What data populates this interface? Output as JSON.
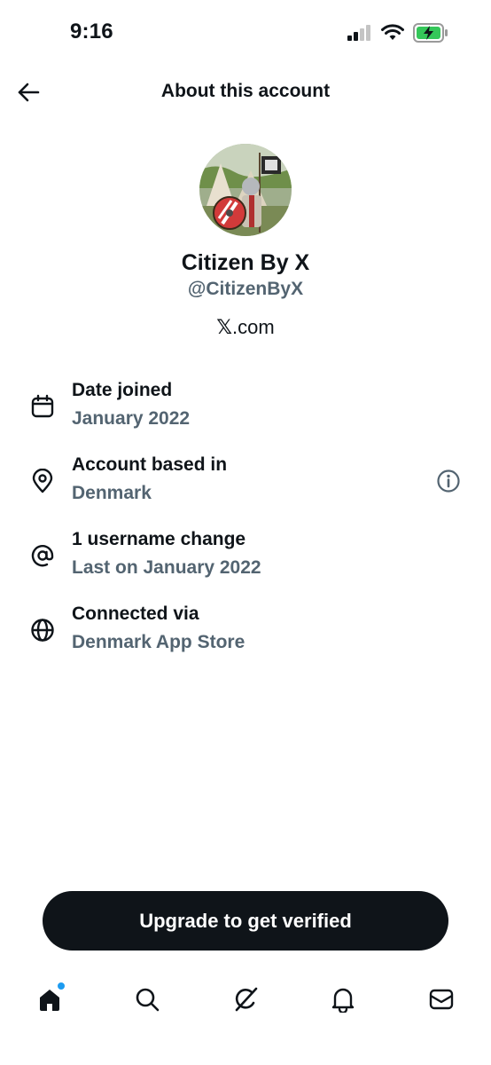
{
  "status_bar": {
    "time": "9:16"
  },
  "header": {
    "title": "About this account"
  },
  "profile": {
    "display_name": "Citizen By X",
    "handle": "@CitizenByX",
    "affiliation": ".com",
    "affiliation_logo": "𝕏"
  },
  "info_rows": [
    {
      "icon": "calendar-icon",
      "title": "Date joined",
      "value": "January 2022"
    },
    {
      "icon": "location-pin-icon",
      "title": "Account based in",
      "value": "Denmark"
    },
    {
      "icon": "at-sign-icon",
      "title": "1 username change",
      "value": "Last on January 2022"
    },
    {
      "icon": "globe-icon",
      "title": "Connected via",
      "value": "Denmark App Store"
    }
  ],
  "upgrade_button": {
    "label": "Upgrade to get verified"
  },
  "bottom_nav": {
    "items": [
      {
        "icon": "home-icon",
        "active": true,
        "has_notification_dot": true
      },
      {
        "icon": "search-icon",
        "active": false
      },
      {
        "icon": "grok-icon",
        "active": false
      },
      {
        "icon": "bell-icon",
        "active": false
      },
      {
        "icon": "mail-icon",
        "active": false
      }
    ]
  },
  "colors": {
    "text_primary": "#0f1419",
    "text_secondary": "#536471",
    "button_bg": "#0f1419",
    "battery_green": "#34c759",
    "notification_dot": "#1d9bf0"
  }
}
